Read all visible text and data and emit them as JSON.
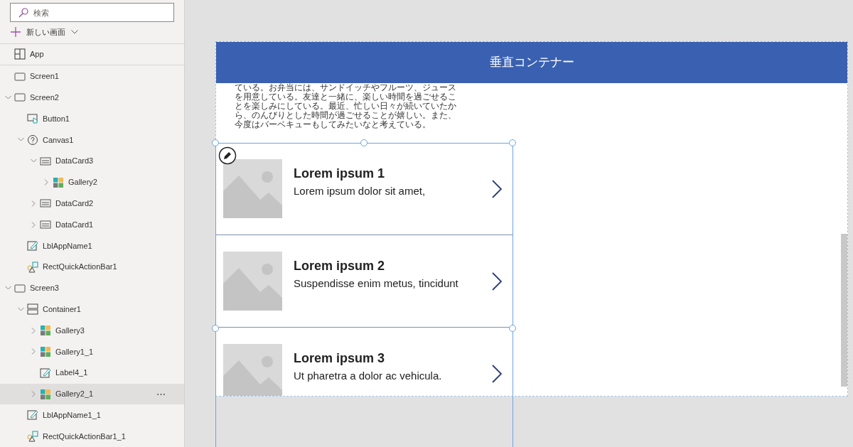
{
  "search": {
    "placeholder": "検索"
  },
  "new_screen": {
    "label": "新しい画面"
  },
  "tree": [
    {
      "label": "App",
      "kind": "app",
      "selected": false
    },
    {
      "label": "Screen1",
      "kind": "screen",
      "selected": false
    },
    {
      "label": "Screen2",
      "kind": "screen",
      "selected": false,
      "expanded": true,
      "children": [
        {
          "label": "Button1",
          "kind": "button",
          "selected": false
        },
        {
          "label": "Canvas1",
          "kind": "canvas",
          "selected": false,
          "expanded": true,
          "children": [
            {
              "label": "DataCard3",
              "kind": "datacard",
              "selected": false,
              "expanded": true,
              "children": [
                {
                  "label": "Gallery2",
                  "kind": "gallery",
                  "selected": false,
                  "expanded": false
                }
              ]
            },
            {
              "label": "DataCard2",
              "kind": "datacard",
              "selected": false,
              "expanded": false
            },
            {
              "label": "DataCard1",
              "kind": "datacard",
              "selected": false,
              "expanded": false
            }
          ]
        },
        {
          "label": "LblAppName1",
          "kind": "label",
          "selected": false
        },
        {
          "label": "RectQuickActionBar1",
          "kind": "rect",
          "selected": false
        }
      ]
    },
    {
      "label": "Screen3",
      "kind": "screen",
      "selected": false,
      "expanded": true,
      "children": [
        {
          "label": "Container1",
          "kind": "container",
          "selected": false,
          "expanded": true,
          "children": [
            {
              "label": "Gallery3",
              "kind": "gallery",
              "selected": false,
              "expanded": false
            },
            {
              "label": "Gallery1_1",
              "kind": "gallery",
              "selected": false,
              "expanded": false
            },
            {
              "label": "Label4_1",
              "kind": "label",
              "selected": false
            },
            {
              "label": "Gallery2_1",
              "kind": "gallery",
              "selected": true,
              "expanded": false,
              "more": "⋯"
            }
          ]
        },
        {
          "label": "LblAppName1_1",
          "kind": "label",
          "selected": false
        },
        {
          "label": "RectQuickActionBar1_1",
          "kind": "rect",
          "selected": false
        }
      ]
    }
  ],
  "screen": {
    "header": "垂直コンテナー",
    "paragraph": "ている。お弁当には、サンドイッチやフルーツ、ジュースを用意している。友達と一緒に、楽しい時間を過ごせることを楽しみにしている。最近、忙しい日々が続いていたから、のんびりとした時間が過ごせることが嬉しい。また、今度はバーベキューもしてみたいなと考えている。",
    "gallery": [
      {
        "title": "Lorem ipsum 1",
        "subtitle": "Lorem ipsum dolor sit amet,"
      },
      {
        "title": "Lorem ipsum 2",
        "subtitle": "Suspendisse enim metus, tincidunt"
      },
      {
        "title": "Lorem ipsum 3",
        "subtitle": "Ut pharetra a dolor ac vehicula."
      }
    ]
  }
}
